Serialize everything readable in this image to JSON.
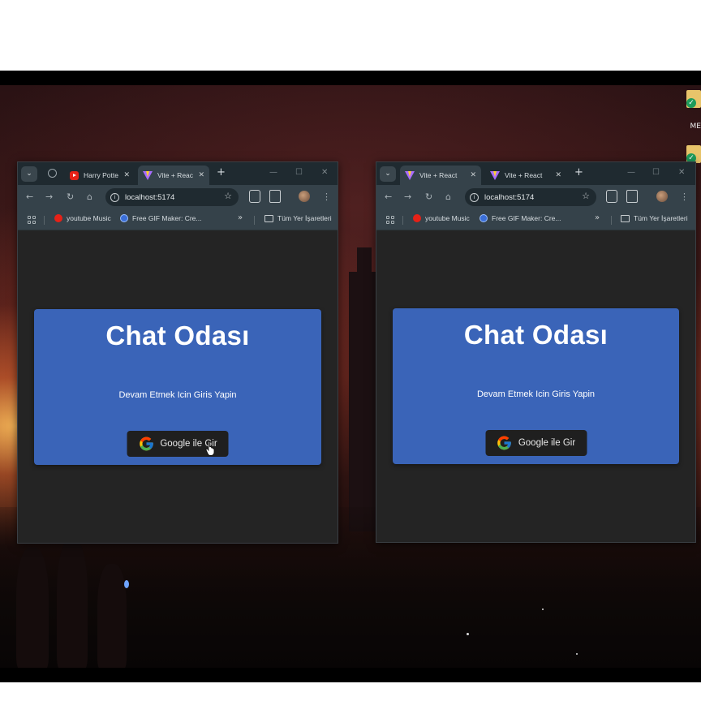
{
  "desktop": {
    "icons": [
      {
        "label": "ME",
        "icon": "folder-icon"
      },
      {
        "label": "",
        "icon": "folder-icon"
      }
    ]
  },
  "left_window": {
    "tabs": [
      {
        "label": "Harry Potte",
        "icon": "youtube-icon",
        "active": false
      },
      {
        "label": "Vite + Reac",
        "icon": "vite-icon",
        "active": true
      }
    ],
    "url": "localhost:5174",
    "bookmarks": [
      {
        "label": "youtube Music",
        "icon": "youtube-music-icon"
      },
      {
        "label": "Free GIF Maker: Cre...",
        "icon": "gif-maker-icon"
      }
    ],
    "all_bookmarks": "Tüm Yer İşaretleri",
    "page": {
      "title": "Chat Odası",
      "subtitle": "Devam Etmek Icin Giris Yapin",
      "button": "Google ile Gir"
    }
  },
  "right_window": {
    "tabs": [
      {
        "label": "Vite + React",
        "icon": "vite-icon",
        "active": true
      },
      {
        "label": "Vite + React",
        "icon": "vite-icon",
        "active": false
      }
    ],
    "url": "localhost:5174",
    "bookmarks": [
      {
        "label": "youtube Music",
        "icon": "youtube-music-icon"
      },
      {
        "label": "Free GIF Maker: Cre...",
        "icon": "gif-maker-icon"
      }
    ],
    "all_bookmarks": "Tüm Yer İşaretleri",
    "page": {
      "title": "Chat Odası",
      "subtitle": "Devam Etmek Icin Giris Yapin",
      "button": "Google ile Gir"
    }
  },
  "colors": {
    "card": "#3a64b8",
    "page_bg": "#242424",
    "button_bg": "#1f1f1f",
    "chrome_toolbar": "#35424a",
    "chrome_tabstrip": "#1f2a30"
  }
}
